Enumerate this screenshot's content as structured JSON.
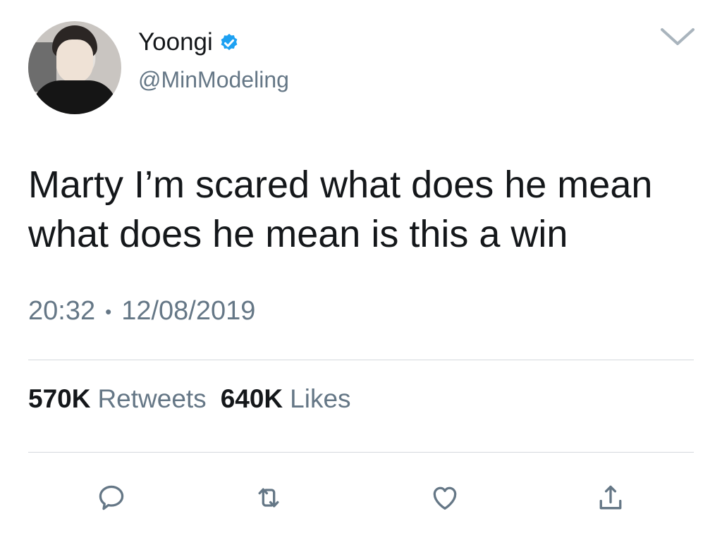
{
  "author": {
    "display_name": "Yoongi",
    "handle": "@MinModeling",
    "verified": true,
    "avatar": "profile-photo"
  },
  "tweet": {
    "text_lines": [
      "Marty I’m scared what does he mean",
      "what does he mean is this a win"
    ],
    "time": "20:32",
    "separator": "•",
    "date": "12/08/2019"
  },
  "stats": {
    "retweets_count": "570K",
    "retweets_label": "Retweets",
    "likes_count": "640K",
    "likes_label": "Likes"
  },
  "actions": {
    "icons": [
      "reply-icon",
      "retweet-icon",
      "like-icon",
      "share-icon"
    ]
  },
  "colors": {
    "text_primary": "#14171a",
    "text_secondary": "#657786",
    "verified_blue": "#1da1f2",
    "divider": "#d4d9dd"
  }
}
